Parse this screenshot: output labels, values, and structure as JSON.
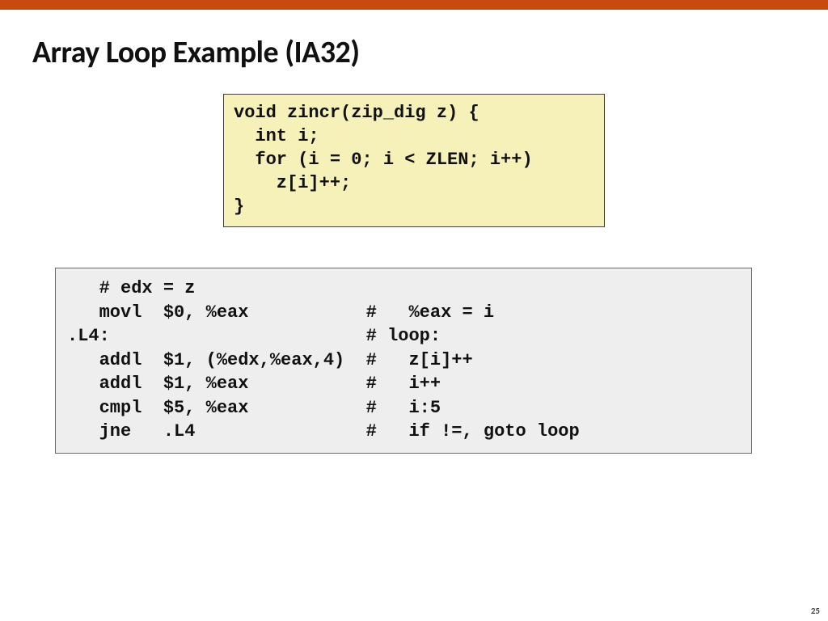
{
  "title": "Array Loop Example (IA32)",
  "c_code": "void zincr(zip_dig z) {\n  int i;\n  for (i = 0; i < ZLEN; i++)\n    z[i]++;\n}",
  "asm_code": "   # edx = z\n   movl  $0, %eax           #   %eax = i\n.L4:                        # loop:\n   addl  $1, (%edx,%eax,4)  #   z[i]++\n   addl  $1, %eax           #   i++\n   cmpl  $5, %eax           #   i:5\n   jne   .L4                #   if !=, goto loop",
  "page_number": "25"
}
